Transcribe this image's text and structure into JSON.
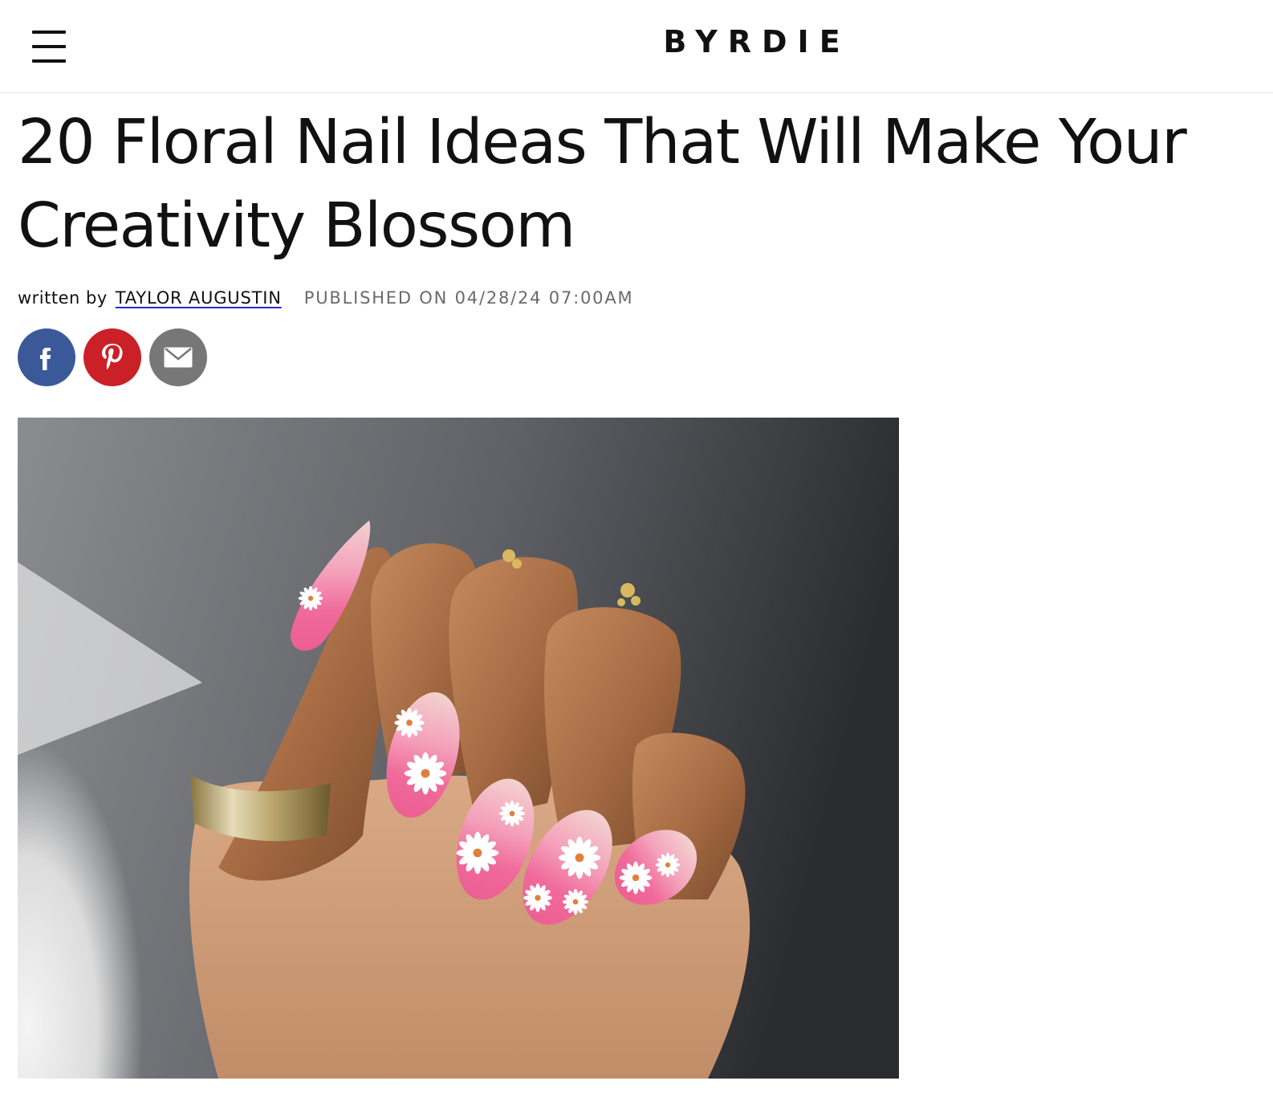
{
  "header": {
    "logo": "BYRDIE",
    "menu_icon": "hamburger-menu-icon"
  },
  "article": {
    "title": "20 Floral Nail Ideas That Will Make Your Creativity Blossom",
    "byline_prefix": "written by",
    "author": "TAYLOR AUGUSTIN",
    "published": "PUBLISHED ON 04/28/24 07:00AM"
  },
  "share": {
    "facebook_icon": "facebook-icon",
    "pinterest_icon": "pinterest-icon",
    "email_icon": "email-icon",
    "colors": {
      "facebook": "#3b5998",
      "pinterest": "#cb2027",
      "email": "#777777"
    }
  },
  "hero_image": {
    "description_icon": "hand-with-floral-nails-image",
    "nail_color": "#f06a9a"
  }
}
